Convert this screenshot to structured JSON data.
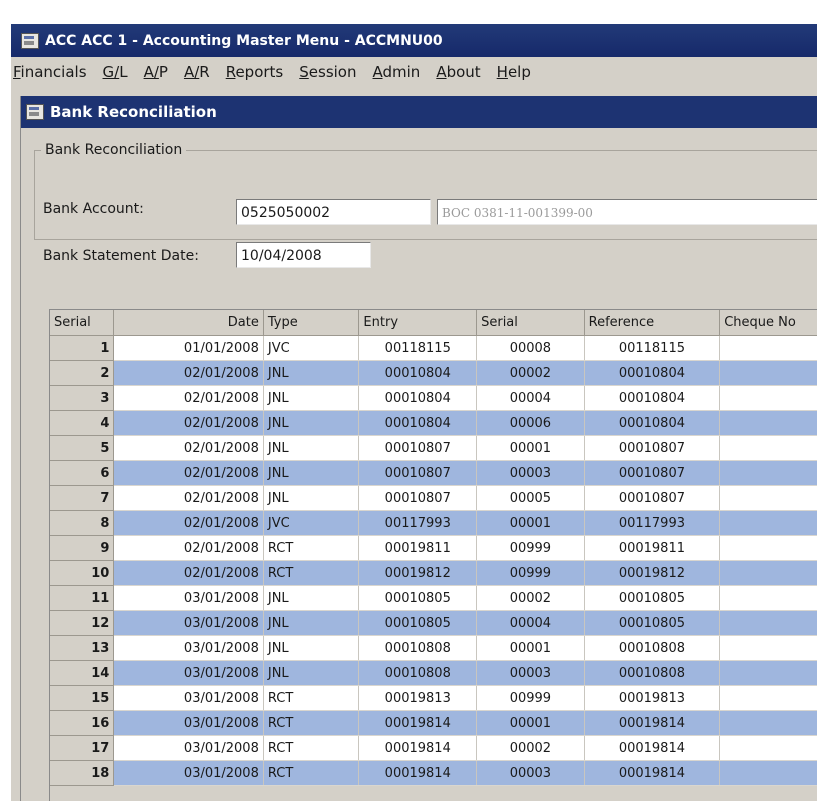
{
  "window": {
    "title": "ACC  ACC 1 - Accounting Master Menu - ACCMNU00"
  },
  "menu": [
    "Financials",
    "G/L",
    "A/P",
    "A/R",
    "Reports",
    "Session",
    "Admin",
    "About",
    "Help"
  ],
  "child": {
    "title": "Bank Reconciliation"
  },
  "group": {
    "legend": "Bank Reconciliation",
    "bank_account_label": "Bank Account:",
    "bank_account_value": "0525050002",
    "bank_account_desc": "BOC 0381-11-001399-00",
    "statement_date_label": "Bank Statement Date:",
    "statement_date_value": "10/04/2008"
  },
  "grid": {
    "columns": [
      "Serial",
      "Date",
      "Type",
      "Entry",
      "Serial",
      "Reference",
      "Cheque No"
    ],
    "rows": [
      [
        "1",
        "01/01/2008",
        "JVC",
        "00118115",
        "00008",
        "00118115"
      ],
      [
        "2",
        "02/01/2008",
        "JNL",
        "00010804",
        "00002",
        "00010804"
      ],
      [
        "3",
        "02/01/2008",
        "JNL",
        "00010804",
        "00004",
        "00010804"
      ],
      [
        "4",
        "02/01/2008",
        "JNL",
        "00010804",
        "00006",
        "00010804"
      ],
      [
        "5",
        "02/01/2008",
        "JNL",
        "00010807",
        "00001",
        "00010807"
      ],
      [
        "6",
        "02/01/2008",
        "JNL",
        "00010807",
        "00003",
        "00010807"
      ],
      [
        "7",
        "02/01/2008",
        "JNL",
        "00010807",
        "00005",
        "00010807"
      ],
      [
        "8",
        "02/01/2008",
        "JVC",
        "00117993",
        "00001",
        "00117993"
      ],
      [
        "9",
        "02/01/2008",
        "RCT",
        "00019811",
        "00999",
        "00019811"
      ],
      [
        "10",
        "02/01/2008",
        "RCT",
        "00019812",
        "00999",
        "00019812"
      ],
      [
        "11",
        "03/01/2008",
        "JNL",
        "00010805",
        "00002",
        "00010805"
      ],
      [
        "12",
        "03/01/2008",
        "JNL",
        "00010805",
        "00004",
        "00010805"
      ],
      [
        "13",
        "03/01/2008",
        "JNL",
        "00010808",
        "00001",
        "00010808"
      ],
      [
        "14",
        "03/01/2008",
        "JNL",
        "00010808",
        "00003",
        "00010808"
      ],
      [
        "15",
        "03/01/2008",
        "RCT",
        "00019813",
        "00999",
        "00019813"
      ],
      [
        "16",
        "03/01/2008",
        "RCT",
        "00019814",
        "00001",
        "00019814"
      ],
      [
        "17",
        "03/01/2008",
        "RCT",
        "00019814",
        "00002",
        "00019814"
      ],
      [
        "18",
        "03/01/2008",
        "RCT",
        "00019814",
        "00003",
        "00019814"
      ]
    ]
  },
  "colors": {
    "title_bar": "#1d3372",
    "row_highlight": "#9fb6de",
    "chrome": "#d4d0c8"
  }
}
